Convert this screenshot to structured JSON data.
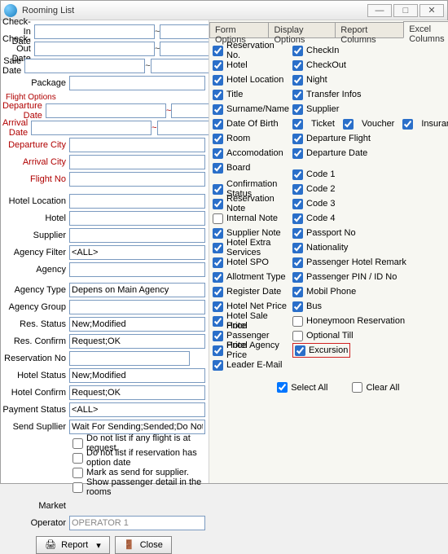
{
  "title": "Rooming List",
  "left": {
    "checkin": "Check-In Date",
    "checkout": "Check-Out Date",
    "saledate": "Sale Date",
    "package": "Package",
    "flightopts": "Flight Options",
    "depdate": "Departure Date",
    "arrdate": "Arrival Date",
    "depcity": "Departure City",
    "arrcity": "Arrival City",
    "flightno": "Flight No",
    "hotelloc": "Hotel Location",
    "hotel": "Hotel",
    "supplier": "Supplier",
    "agfilter": "Agency Filter",
    "agfilter_v": "<ALL>",
    "agency": "Agency",
    "agtype": "Agency Type",
    "agtype_v": "Depens on Main Agency",
    "aggroup": "Agency Group",
    "resstatus": "Res. Status",
    "resstatus_v": "New;Modified",
    "resconfirm": "Res. Confirm",
    "resconfirm_v": "Request;OK",
    "resno": "Reservation No",
    "hotstatus": "Hotel Status",
    "hotstatus_v": "New;Modified",
    "hotconfirm": "Hotel Confirm",
    "hotconfirm_v": "Request;OK",
    "paystatus": "Payment Status",
    "paystatus_v": "<ALL>",
    "sendsup": "Send Supllier",
    "sendsup_v": "Wait For Sending;Sended;Do Not Send",
    "c1": "Do not list if any flight is at request.",
    "c2": "Do not list if reservation has option date",
    "c3": "Mark as send for supplier.",
    "c4": "Show passenger detail in the rooms",
    "market": "Market",
    "operator": "Operator",
    "operator_v": "OPERATOR 1",
    "report": "Report",
    "close": "Close"
  },
  "tabs": {
    "t1": "Form Options",
    "t2": "Display Options",
    "t3": "Report Columns",
    "t4": "Excel Columns"
  },
  "cols1": [
    "Reservation No.",
    "Hotel",
    "Hotel Location",
    "Title",
    "Surname/Name",
    "Date Of Birth",
    "Room",
    "Accomodation",
    "Board"
  ],
  "cols1b": [
    {
      "l": "Confirmation Status",
      "c": true
    },
    {
      "l": "Reservation Note",
      "c": true
    },
    {
      "l": "Internal Note",
      "c": false
    },
    {
      "l": "Supplier Note",
      "c": true
    },
    {
      "l": "Hotel Extra Services",
      "c": true
    },
    {
      "l": "Hotel SPO",
      "c": true
    },
    {
      "l": "Allotment Type",
      "c": true
    },
    {
      "l": "Register Date",
      "c": true
    },
    {
      "l": "Hotel Net Price",
      "c": true
    },
    {
      "l": "Hotel Sale Price",
      "c": true
    },
    {
      "l": "Hotel Passenger Price",
      "c": true
    },
    {
      "l": "Hotel Agency Price",
      "c": true
    },
    {
      "l": "Leader E-Mail",
      "c": true
    }
  ],
  "cols2": [
    "CheckIn",
    "CheckOut",
    "Night",
    "Transfer Infos",
    "Supplier"
  ],
  "cols2_inline": {
    "a": "Ticket",
    "b": "Voucher",
    "c": "Insurance"
  },
  "cols2b": [
    "Departure Flight",
    "Departure Date"
  ],
  "cols2c": [
    {
      "l": "Code 1",
      "c": true
    },
    {
      "l": "Code 2",
      "c": true
    },
    {
      "l": "Code 3",
      "c": true
    },
    {
      "l": "Code 4",
      "c": true
    },
    {
      "l": "Passport No",
      "c": true
    },
    {
      "l": "Nationality",
      "c": true
    },
    {
      "l": "Passenger Hotel Remark",
      "c": true
    },
    {
      "l": "Passenger PIN / ID No",
      "c": true
    },
    {
      "l": "Mobil Phone",
      "c": true
    },
    {
      "l": "Bus",
      "c": true
    },
    {
      "l": "Honeymoon Reservation",
      "c": false
    },
    {
      "l": "Optional Till",
      "c": false
    },
    {
      "l": "Excursion",
      "c": true,
      "hl": true
    }
  ],
  "selall": "Select All",
  "clrall": "Clear All"
}
